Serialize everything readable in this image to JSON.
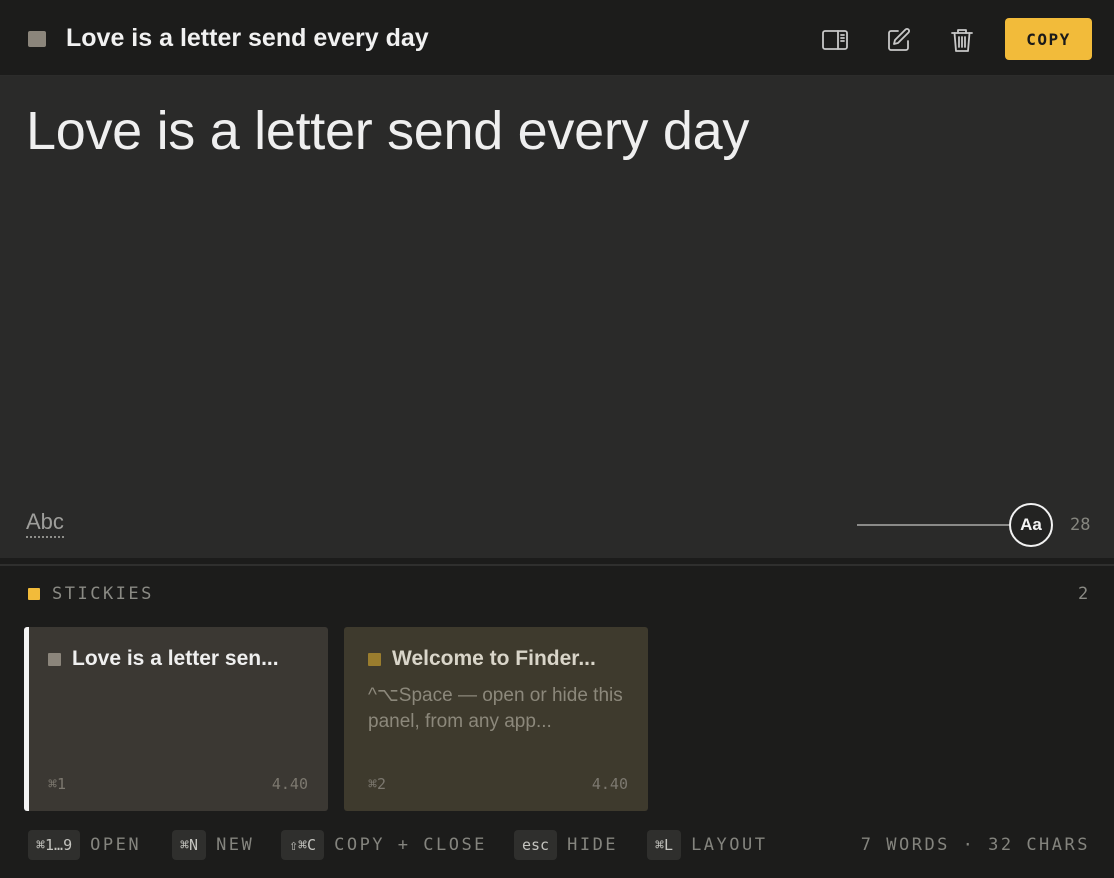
{
  "header": {
    "title": "Love is a letter send every day",
    "swatch_color": "#8b857b",
    "icons": [
      "sidebar-toggle-icon",
      "edit-icon",
      "trash-icon"
    ],
    "copy_label": "COPY",
    "accent_color": "#f2bb3a"
  },
  "editor": {
    "content": "Love is a letter send every day",
    "spellcheck_label": "Abc",
    "font_button_label": "Aa",
    "font_size": "28",
    "font_slider_level": 1.0
  },
  "stickies": {
    "label": "STICKIES",
    "count": "2",
    "cards": [
      {
        "title": "Love is a letter sen...",
        "preview": "",
        "shortcut": "⌘1",
        "time": "4.40",
        "selected": true,
        "color": "#8b857b"
      },
      {
        "title": "Welcome to Finder...",
        "preview": "^⌥Space — open or hide this panel, from any app...",
        "shortcut": "⌘2",
        "time": "4.40",
        "selected": false,
        "color": "#9a7d2e"
      }
    ]
  },
  "footer": {
    "shortcuts": [
      {
        "key": "⌘1…9",
        "label": "OPEN"
      },
      {
        "key": "⌘N",
        "label": "NEW"
      },
      {
        "key": "⇧⌘C",
        "label": "COPY + CLOSE"
      },
      {
        "key": "esc",
        "label": "HIDE"
      },
      {
        "key": "⌘L",
        "label": "LAYOUT"
      }
    ],
    "stats": "7 WORDS · 32 CHARS"
  }
}
